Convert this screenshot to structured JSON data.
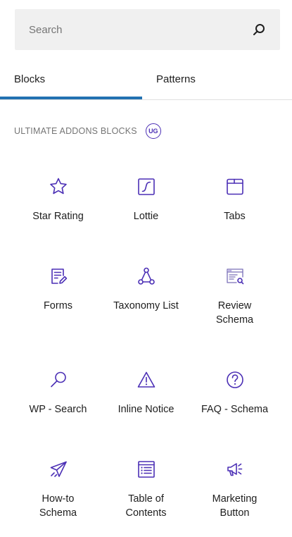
{
  "search": {
    "placeholder": "Search"
  },
  "tabs": [
    {
      "label": "Blocks",
      "active": true
    },
    {
      "label": "Patterns",
      "active": false
    }
  ],
  "section": {
    "title": "ULTIMATE ADDONS BLOCKS",
    "badge": "UG"
  },
  "blocks": [
    {
      "label": "Star Rating",
      "icon": "star-icon"
    },
    {
      "label": "Lottie",
      "icon": "lottie-icon"
    },
    {
      "label": "Tabs",
      "icon": "tabs-icon"
    },
    {
      "label": "Forms",
      "icon": "forms-icon"
    },
    {
      "label": "Taxonomy List",
      "icon": "taxonomy-icon"
    },
    {
      "label": "Review\nSchema",
      "icon": "review-schema-icon"
    },
    {
      "label": "WP - Search",
      "icon": "search-magnifier-icon"
    },
    {
      "label": "Inline Notice",
      "icon": "warning-icon"
    },
    {
      "label": "FAQ - Schema",
      "icon": "question-icon"
    },
    {
      "label": "How-to\nSchema",
      "icon": "paper-plane-icon"
    },
    {
      "label": "Table of\nContents",
      "icon": "table-of-contents-icon"
    },
    {
      "label": "Marketing\nButton",
      "icon": "megaphone-icon"
    }
  ],
  "colors": {
    "accent": "#2271b1",
    "icon": "#4b2fb5",
    "search_bg": "#f0f0f0"
  }
}
